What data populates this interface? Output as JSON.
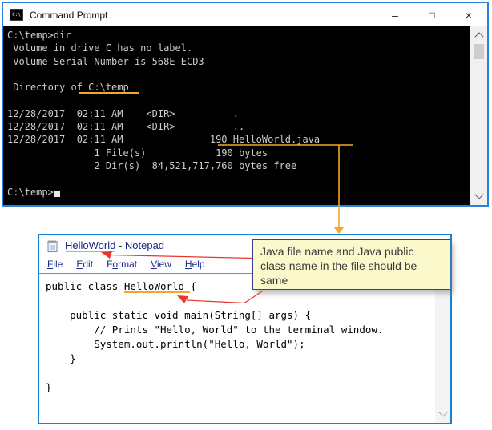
{
  "cmd_window": {
    "icon_text": "C:\\",
    "title": "Command Prompt",
    "controls": {
      "minimize": "–",
      "maximize": "□",
      "close": "×"
    },
    "console_text": "C:\\temp>dir\n Volume in drive C has no label.\n Volume Serial Number is 568E-ECD3\n\n Directory of C:\\temp\n\n12/28/2017  02:11 AM    <DIR>          .\n12/28/2017  02:11 AM    <DIR>          ..\n12/28/2017  02:11 AM               190 HelloWorld.java\n               1 File(s)            190 bytes\n               2 Dir(s)  84,521,717,760 bytes free\n\nC:\\temp>"
  },
  "notepad_window": {
    "title": "HelloWorld - Notepad",
    "menu": [
      {
        "pre": "",
        "mn": "F",
        "post": "ile"
      },
      {
        "pre": "",
        "mn": "E",
        "post": "dit"
      },
      {
        "pre": "F",
        "mn": "o",
        "post": "rmat"
      },
      {
        "pre": "",
        "mn": "V",
        "post": "iew"
      },
      {
        "pre": "",
        "mn": "H",
        "post": "elp"
      }
    ],
    "code_text": "public class HelloWorld {\n\n    public static void main(String[] args) {\n        // Prints \"Hello, World\" to the terminal window.\n        System.out.println(\"Hello, World\");\n    }\n\n}"
  },
  "callout": {
    "text": "Java file name and Java public class name in the file should be same"
  },
  "colors": {
    "window_border_blue": "#1383d8",
    "console_bg": "#000000",
    "console_text": "#cccccc",
    "highlight_orange": "#f3a72b",
    "annotation_red": "#e8382e",
    "menu_navy": "#1d2b8d",
    "callout_bg": "#fbf8cc",
    "callout_border": "#3b3f94"
  }
}
